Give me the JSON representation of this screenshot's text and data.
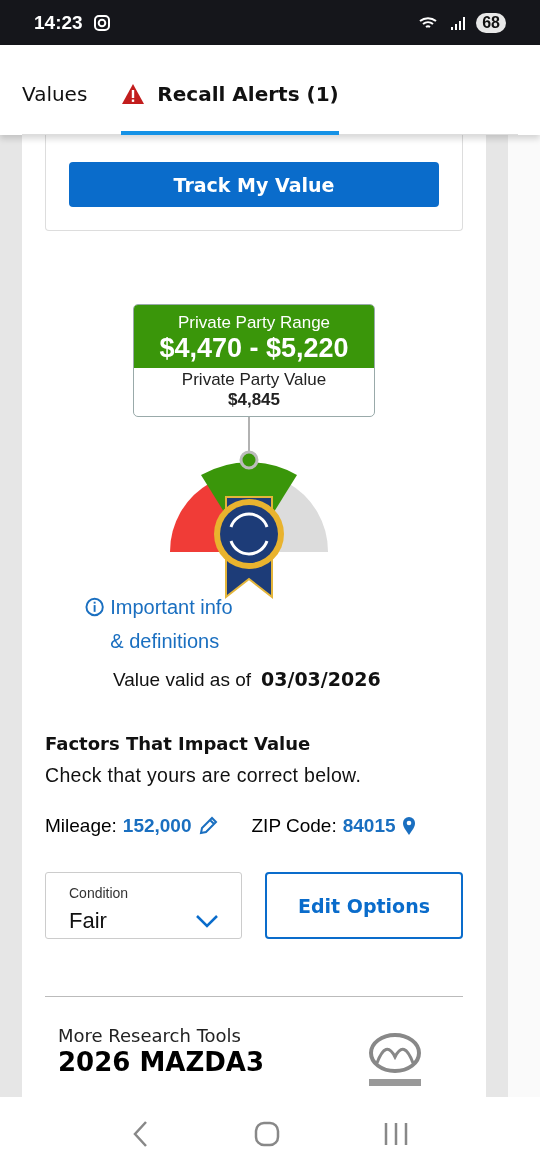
{
  "status_bar": {
    "time": "14:23",
    "battery": "68"
  },
  "tabs": [
    {
      "label": "Values",
      "selected": false,
      "kind": "plain"
    },
    {
      "label": "Recall Alerts (1)",
      "selected": true,
      "kind": "alert"
    }
  ],
  "track_card": {
    "button": "Track My Value"
  },
  "price_box": {
    "title": "Private Party Range",
    "range": "$4,470 - $5,220",
    "value_label": "Private Party Value",
    "value": "$4,845"
  },
  "info_link": "Important info & definitions",
  "valid": {
    "label": "Value valid as of",
    "date": "03/03/2026"
  },
  "factors": {
    "heading": "Factors That Impact Value",
    "subtitle": "Check that yours are correct below.",
    "mileage": {
      "label": "Mileage:",
      "value": "152,000"
    },
    "zip": {
      "label": "ZIP Code:",
      "value": "84015"
    }
  },
  "condition": {
    "label": "Condition",
    "value": "Fair"
  },
  "edit_button": "Edit Options",
  "research": {
    "label": "More Research Tools",
    "title": "2026 MAZDA3"
  }
}
